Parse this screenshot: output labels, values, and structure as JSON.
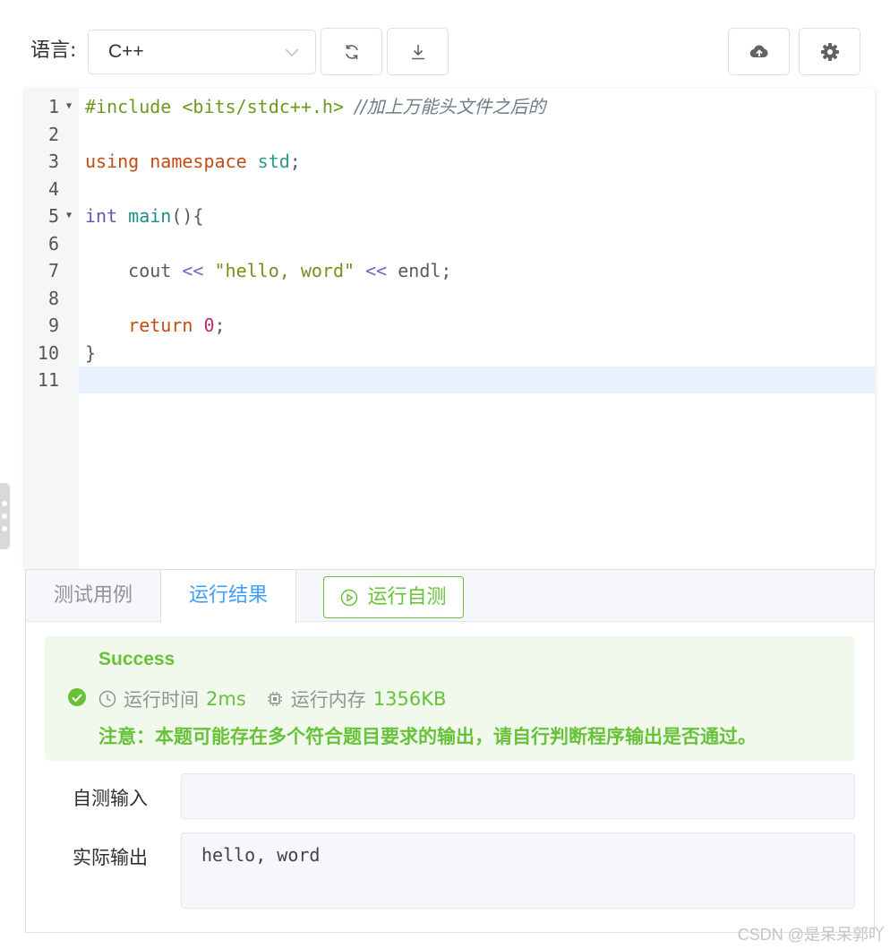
{
  "toolbar": {
    "language_label": "语言:",
    "language_value": "C++",
    "icons": [
      "refresh-icon",
      "download-icon",
      "cloud-upload-icon",
      "gear-icon"
    ]
  },
  "editor": {
    "lines": [
      {
        "n": "1",
        "fold": true,
        "tokens": [
          {
            "t": "#include <bits/stdc++.h>",
            "c": "pre"
          },
          {
            "t": " ",
            "c": "plain"
          },
          {
            "t": "//加上万能头文件之后的",
            "c": "com"
          }
        ]
      },
      {
        "n": "2",
        "fold": false,
        "tokens": []
      },
      {
        "n": "3",
        "fold": false,
        "tokens": [
          {
            "t": "using namespace",
            "c": "kw"
          },
          {
            "t": " ",
            "c": "plain"
          },
          {
            "t": "std",
            "c": "id"
          },
          {
            "t": ";",
            "c": "plain"
          }
        ]
      },
      {
        "n": "4",
        "fold": false,
        "tokens": []
      },
      {
        "n": "5",
        "fold": true,
        "tokens": [
          {
            "t": "int",
            "c": "type"
          },
          {
            "t": " ",
            "c": "plain"
          },
          {
            "t": "main",
            "c": "fn"
          },
          {
            "t": "(){",
            "c": "plain"
          }
        ]
      },
      {
        "n": "6",
        "fold": false,
        "tokens": []
      },
      {
        "n": "7",
        "fold": false,
        "tokens": [
          {
            "t": "    cout ",
            "c": "plain"
          },
          {
            "t": "<<",
            "c": "op"
          },
          {
            "t": " ",
            "c": "plain"
          },
          {
            "t": "\"hello, word\"",
            "c": "str"
          },
          {
            "t": " ",
            "c": "plain"
          },
          {
            "t": "<<",
            "c": "op"
          },
          {
            "t": " endl;",
            "c": "plain"
          }
        ]
      },
      {
        "n": "8",
        "fold": false,
        "tokens": []
      },
      {
        "n": "9",
        "fold": false,
        "tokens": [
          {
            "t": "    ",
            "c": "plain"
          },
          {
            "t": "return",
            "c": "kw"
          },
          {
            "t": " ",
            "c": "plain"
          },
          {
            "t": "0",
            "c": "num"
          },
          {
            "t": ";",
            "c": "plain"
          }
        ]
      },
      {
        "n": "10",
        "fold": false,
        "tokens": [
          {
            "t": "}",
            "c": "plain"
          }
        ]
      },
      {
        "n": "11",
        "fold": false,
        "active": true,
        "tokens": []
      }
    ]
  },
  "panel": {
    "tabs": [
      {
        "label": "测试用例",
        "active": false
      },
      {
        "label": "运行结果",
        "active": true
      }
    ],
    "run_button_label": "运行自测",
    "result": {
      "status": "Success",
      "time_label": "运行时间",
      "time_value": "2ms",
      "memory_label": "运行内存",
      "memory_value": "1356KB",
      "note": "注意：本题可能存在多个符合题目要求的输出，请自行判断程序输出是否通过。"
    },
    "input_label": "自测输入",
    "input_value": "",
    "output_label": "实际输出",
    "output_value": "hello, word"
  },
  "watermark": "CSDN @是呆呆郭吖",
  "colors": {
    "success": "#67c23a",
    "active_tab": "#409eff",
    "success_bg": "#f0f9eb",
    "active_line": "#e8f2fe"
  }
}
